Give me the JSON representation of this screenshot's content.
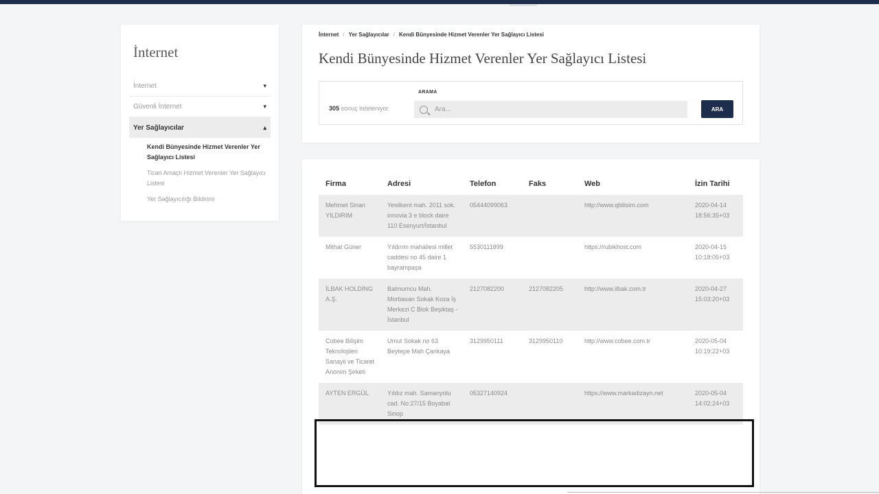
{
  "sidebar": {
    "title": "İnternet",
    "items": [
      {
        "label": "İnternet"
      },
      {
        "label": "Güvenli İnternet"
      },
      {
        "label": "Yer Sağlayıcılar"
      }
    ],
    "subitems": [
      {
        "label": "Kendi Bünyesinde Hizmet Verenler Yer Sağlayıcı Listesi"
      },
      {
        "label": "Ticari Amaçlı Hizmet Verenler Yer Sağlayıcı Listesi"
      },
      {
        "label": "Yer Sağlayıcılığı Bildirimi"
      }
    ]
  },
  "breadcrumb": [
    "İnternet",
    "Yer Sağlayıcılar",
    "Kendi Bünyesinde Hizmet Verenler Yer Sağlayıcı Listesi"
  ],
  "page_title": "Kendi Bünyesinde Hizmet Verenler Yer Sağlayıcı Listesi",
  "search": {
    "count": "305",
    "count_suffix": "sonuç listeleniyor",
    "label": "ARAMA",
    "placeholder": "Ara...",
    "button": "ARA"
  },
  "table": {
    "headers": [
      "Firma",
      "Adresi",
      "Telefon",
      "Faks",
      "Web",
      "İzin Tarihi"
    ],
    "rows": [
      {
        "firma": "Mehmet Sinan YILDIRIM",
        "adres": "Yesilkent mah. 2011 sok. innovia 3 e block daire 110 Esenyurt/İstanbul",
        "telefon": "05444099063",
        "faks": "",
        "web": "http://www.qbilisim.com",
        "tarih": "2020-04-14 18:56:35+03"
      },
      {
        "firma": "Mithat Güner",
        "adres": "Yıldırım mahallesi millet caddesi no 45 daire 1 bayrampaşa",
        "telefon": "5530111899",
        "faks": "",
        "web": "https://rubikhost.com",
        "tarih": "2020-04-15 10:18:05+03"
      },
      {
        "firma": "İLBAK HOLDİNG A.Ş.",
        "adres": "Balmumcu Mah. Morbasan Sokak Koza İş Merkezi C Blok Beşiktaş - İstanbul",
        "telefon": "2127082200",
        "faks": "2127082205",
        "web": "http://www.ilbak.com.tr",
        "tarih": "2020-04-27 15:03:20+03"
      },
      {
        "firma": "Cobee Bilişim Teknolojileri Sanayii ve Ticaret Anonim Şirketi",
        "adres": "Umut Sokak no 63 Beytepe Mah Çankaya",
        "telefon": "3129950111",
        "faks": "3129950110",
        "web": "http://www.cobee.com.tr",
        "tarih": "2020-05-04 10:19:22+03"
      },
      {
        "firma": "AYTEN ERGÜL",
        "adres": "Yıldız mah. Samanyolu cad. No:27/15 Boyabat Sinop",
        "telefon": "05327140924",
        "faks": "",
        "web": "https://www.markadizayn.net",
        "tarih": "2020-05-04 14:02:24+03"
      }
    ]
  }
}
